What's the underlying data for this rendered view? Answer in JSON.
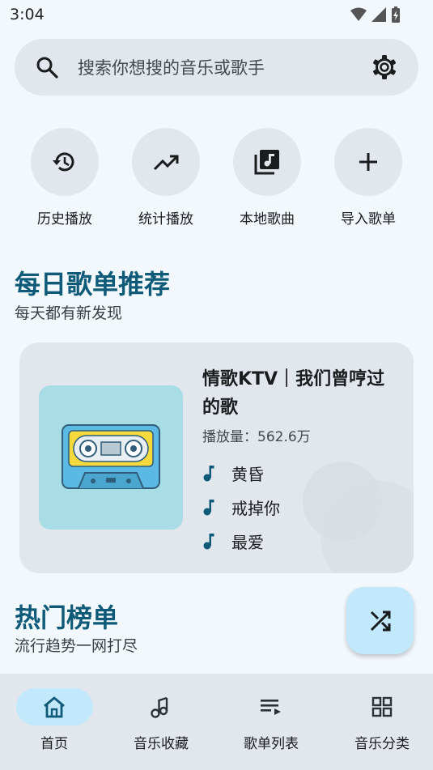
{
  "status_bar": {
    "time": "3:04",
    "icons": [
      "wifi-icon",
      "signal-icon",
      "battery-charging-icon"
    ]
  },
  "search": {
    "placeholder": "搜索你想搜的音乐或歌手",
    "icon": "search-icon",
    "settings_icon": "gear-icon"
  },
  "quick_actions": [
    {
      "label": "历史播放",
      "icon": "history-icon"
    },
    {
      "label": "统计播放",
      "icon": "trending-up-icon"
    },
    {
      "label": "本地歌曲",
      "icon": "library-music-icon"
    },
    {
      "label": "导入歌单",
      "icon": "add-icon"
    }
  ],
  "daily": {
    "title": "每日歌单推荐",
    "subtitle": "每天都有新发现",
    "playlist": {
      "title": "情歌KTV｜我们曾哼过的歌",
      "play_count": "播放量：562.6万",
      "cover": "cassette-tape-image",
      "songs": [
        "黄昏",
        "戒掉你",
        "最爱"
      ]
    }
  },
  "hot": {
    "title": "热门榜单",
    "subtitle": "流行趋势一网打尽"
  },
  "fab": {
    "icon": "shuffle-icon"
  },
  "colors": {
    "accent": "#0e5a78",
    "active_pill": "#c2e8fb",
    "surface": "#e2e7ee",
    "background": "#f3f8fd"
  },
  "bottom_nav": [
    {
      "label": "首页",
      "icon": "home-icon",
      "active": true
    },
    {
      "label": "音乐收藏",
      "icon": "music-note-favorite-icon",
      "active": false
    },
    {
      "label": "歌单列表",
      "icon": "playlist-icon",
      "active": false
    },
    {
      "label": "音乐分类",
      "icon": "grid-category-icon",
      "active": false
    }
  ]
}
